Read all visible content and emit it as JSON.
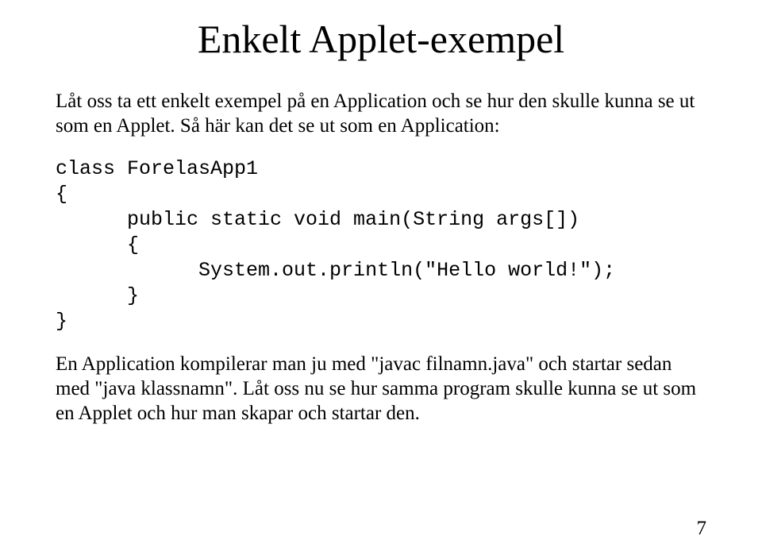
{
  "title": "Enkelt Applet-exempel",
  "para1": "Låt oss ta ett enkelt exempel på en Application och se hur den skulle kunna se ut som en Applet. Så här kan det se ut som en Application:",
  "code": "class ForelasApp1\n{\n      public static void main(String args[])\n      {\n            System.out.println(\"Hello world!\");\n      }\n}",
  "para2": "En Application kompilerar man ju med \"javac filnamn.java\" och startar sedan med \"java klassnamn\". Låt oss nu se hur samma program skulle kunna se ut som en Applet och hur man skapar och startar den.",
  "pageNumber": "7"
}
